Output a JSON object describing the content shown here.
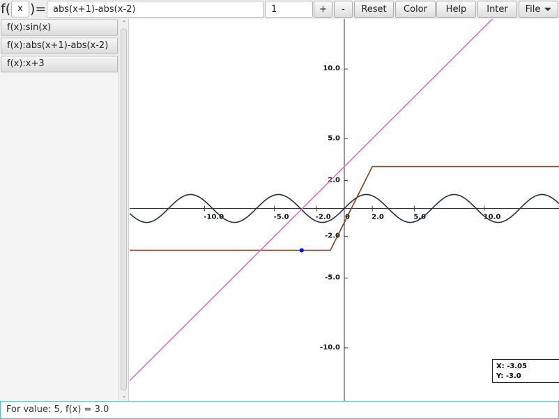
{
  "toolbar": {
    "f_prefix": "f(",
    "variable": "x",
    "f_suffix": ")=",
    "expression": "abs(x+1)-abs(x-2)",
    "step": "1",
    "plus_label": "+",
    "minus_label": "-",
    "reset_label": "Reset",
    "color_label": "Color",
    "help_label": "Help",
    "inter_label": "Inter",
    "file_label": "File"
  },
  "sidebar": {
    "items": [
      {
        "label": "f(x):sin(x)"
      },
      {
        "label": "f(x):abs(x+1)-abs(x-2)"
      },
      {
        "label": "f(x):x+3"
      }
    ]
  },
  "graph": {
    "x_ticks": [
      -10,
      -5,
      -2,
      2,
      5,
      10
    ],
    "y_ticks": [
      10,
      5,
      2,
      -2,
      -5,
      -10
    ],
    "x_tick_labels": [
      "-10.0",
      "-5.0",
      "-2.0",
      "2.0",
      "5.0",
      "10.0"
    ],
    "y_tick_labels": [
      "10.0",
      "5.0",
      "2.0",
      "-2.0",
      "-5.0",
      "-10.0"
    ],
    "origin_label": "0",
    "x_range": [
      -15.35,
      15.35
    ],
    "y_range": [
      -13.8,
      13.6
    ],
    "functions": [
      {
        "expr": "sin(x)",
        "color": "#1e2f4a"
      },
      {
        "expr": "abs(x+1)-abs(x-2)",
        "color": "#8b3a14"
      },
      {
        "expr": "x+3",
        "color": "#e070c8"
      }
    ],
    "marker": {
      "x": -3.05,
      "y": -3.0,
      "color": "#0000ff"
    }
  },
  "coords": {
    "x_text": "X: -3.05",
    "y_text": "Y: -3.0"
  },
  "status": {
    "text": "For value: 5, f(x) = 3.0"
  }
}
